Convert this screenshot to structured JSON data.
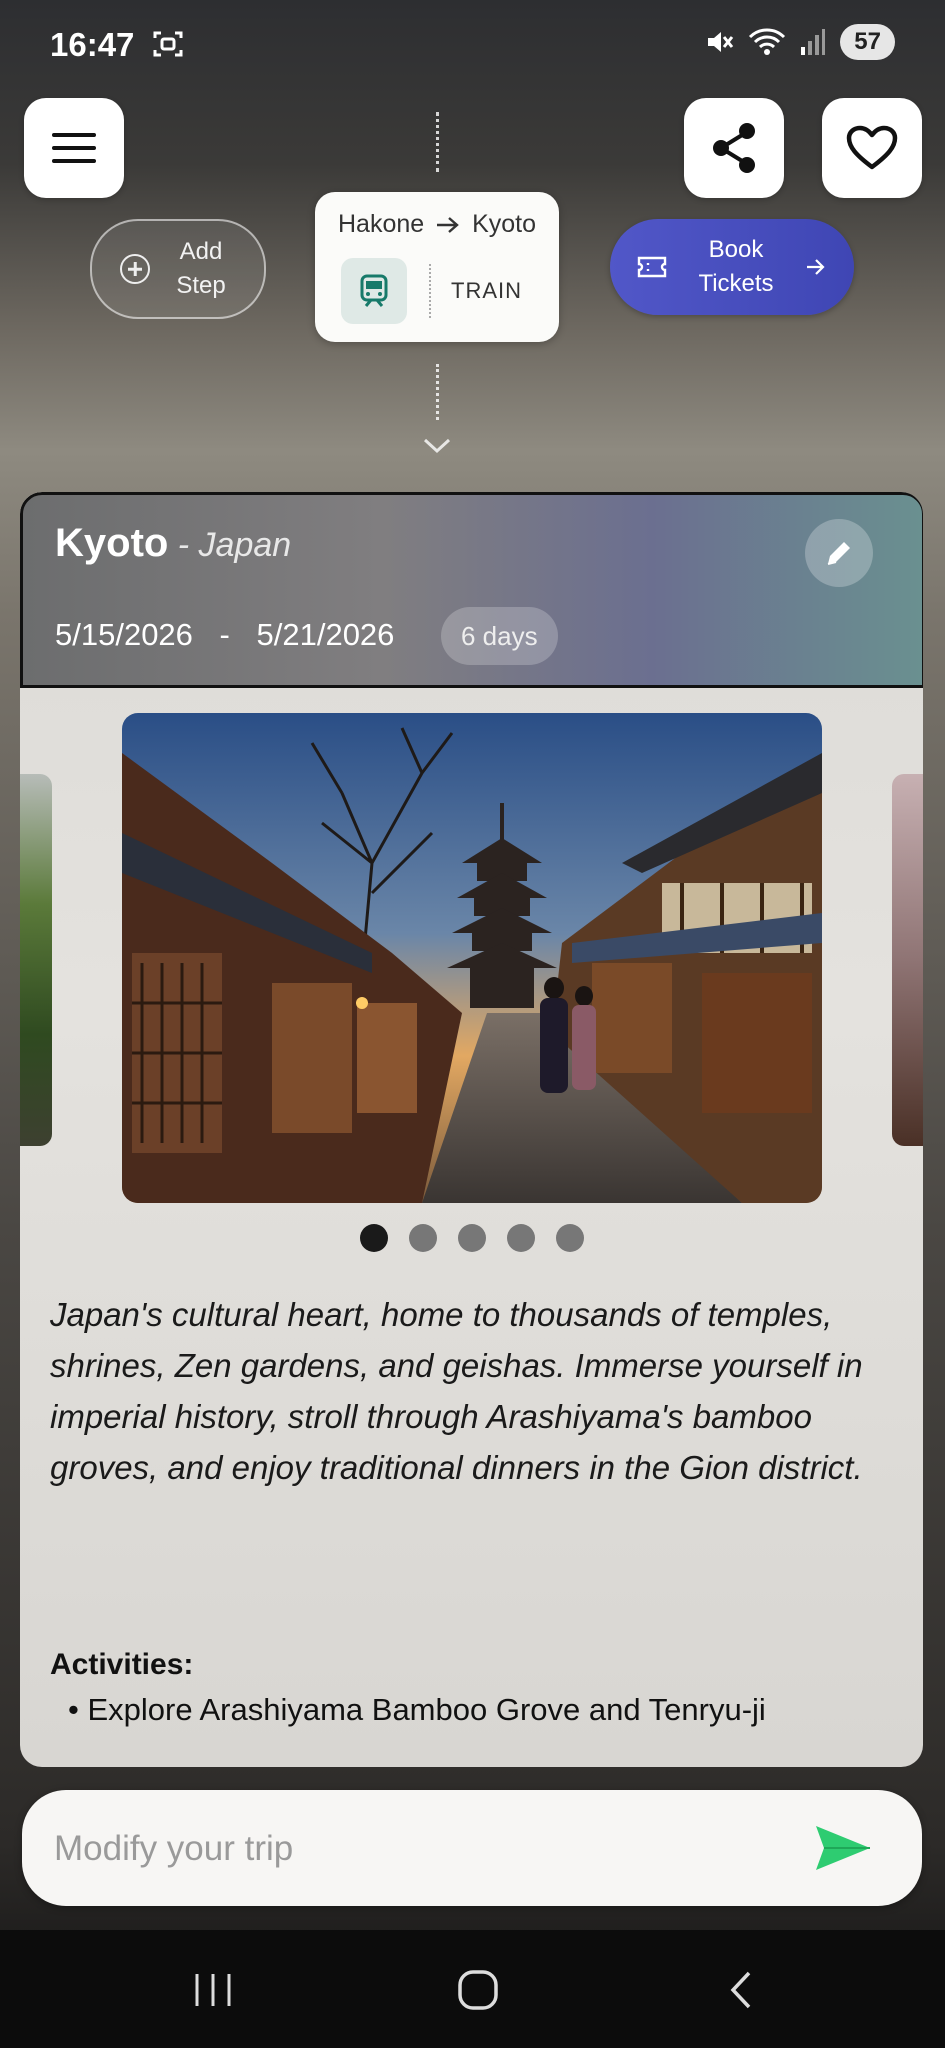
{
  "status_bar": {
    "time": "16:47",
    "battery": "57"
  },
  "transit": {
    "from": "Hakone",
    "to": "Kyoto",
    "mode": "TRAIN"
  },
  "add_step": {
    "label": "Add Step"
  },
  "book": {
    "label": "Book Tickets"
  },
  "destination": {
    "city": "Kyoto",
    "country": "Japan",
    "country_sep": " - ",
    "start_date": "5/15/2026",
    "date_sep": "-",
    "end_date": "5/21/2026",
    "duration": "6 days",
    "image_count": 5,
    "active_image": 0,
    "description": "Japan's cultural heart, home to thousands of temples, shrines, Zen gardens, and geishas. Immerse yourself in imperial history, stroll through Arashiyama's bamboo groves, and enjoy traditional dinners in the Gion district.",
    "activities_title": "Activities:",
    "activities": [
      "Explore Arashiyama Bamboo Grove and Tenryu-ji"
    ]
  },
  "input": {
    "placeholder": "Modify your trip"
  },
  "icons": [
    "screenshot-icon",
    "mute-icon",
    "wifi-icon",
    "signal-icon",
    "menu-icon",
    "share-icon",
    "heart-icon",
    "plus-icon",
    "train-icon",
    "arrow-right-icon",
    "ticket-icon",
    "chevron-down-icon",
    "edit-icon",
    "send-icon",
    "recents-icon",
    "home-icon",
    "back-icon"
  ],
  "colors": {
    "accent": "#4b50c0",
    "send": "#2ecc71",
    "train_icon": "#177a6a"
  }
}
